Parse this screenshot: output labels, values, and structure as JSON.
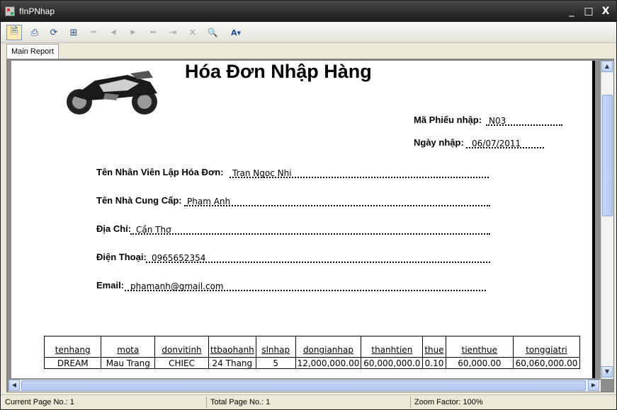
{
  "window": {
    "title": "fInPNhap",
    "controls": [
      "_",
      "□",
      "X"
    ]
  },
  "toolbar": {
    "buttons": [
      {
        "name": "export-icon",
        "glyph": "🗎"
      },
      {
        "name": "print-icon",
        "glyph": "⎙"
      },
      {
        "name": "refresh-icon",
        "glyph": "⟳"
      },
      {
        "name": "toggle-tree-icon",
        "glyph": "⊞"
      },
      {
        "name": "first-page-icon",
        "glyph": "⏮"
      },
      {
        "name": "previous-page-icon",
        "glyph": "◀"
      },
      {
        "name": "next-page-icon",
        "glyph": "▶"
      },
      {
        "name": "last-page-icon",
        "glyph": "⏭"
      },
      {
        "name": "goto-page-icon",
        "glyph": "⇥"
      },
      {
        "name": "stop-icon",
        "glyph": "✕"
      },
      {
        "name": "find-icon",
        "glyph": "🔍"
      },
      {
        "name": "zoom-icon",
        "glyph": "A▾"
      }
    ]
  },
  "tabs": [
    {
      "label": "Main Report"
    }
  ],
  "report": {
    "title": "Hóa Đơn Nhập Hàng",
    "ma_phieu_label": "Mã Phiếu nhập:",
    "ma_phieu_value": "N03",
    "ngay_label": "Ngày nhập:",
    "ngay_value": "06/07/2011",
    "nhanvien_label": "Tên Nhân Viên Lập Hóa Đơn:",
    "nhanvien_value": "Tran Ngoc Nhi",
    "ncc_label": "Tên Nhà Cung Cấp:",
    "ncc_value": "Pham Anh",
    "diachi_label": "Địa Chỉ:",
    "diachi_value": "Cần Thơ",
    "dienthoai_label": "Điện Thoại:",
    "dienthoai_value": "0965652354",
    "email_label": "Email:",
    "email_value": "phamanh@gmail.com",
    "table": {
      "headers": [
        "tenhang",
        "mota",
        "donvitinh",
        "ttbaohanh",
        "slnhap",
        "dongianhap",
        "thanhtien",
        "thue",
        "tienthue",
        "tonggiatri"
      ],
      "rows": [
        [
          "DREAM",
          "Mau Trang",
          "CHIEC",
          "24 Thang",
          "5",
          "12,000,000.00",
          "60,000,000.0",
          "0.10",
          "60,000.00",
          "60,060,000.00"
        ]
      ]
    }
  },
  "status": {
    "current_page": "Current Page No.: 1",
    "total_page": "Total Page No.: 1",
    "zoom": "Zoom Factor: 100%"
  },
  "colors": {
    "titlebar": "#2b2b2b",
    "viewer_bg": "#8d8d8d",
    "scroll_thumb": "#b9cdf5"
  }
}
